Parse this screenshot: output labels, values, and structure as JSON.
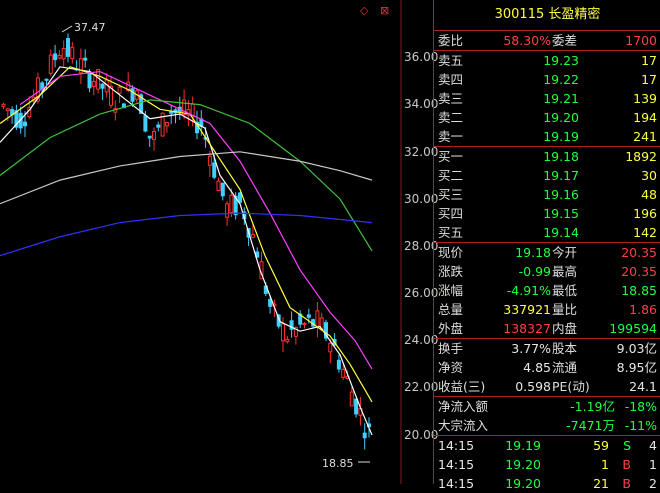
{
  "toolbar": {
    "icons": "◇ ⊠"
  },
  "chart": {
    "y_labels": [
      "36.00",
      "34.00",
      "32.00",
      "30.00",
      "28.00",
      "26.00",
      "24.00",
      "22.00",
      "20.00"
    ],
    "high_label": "37.47",
    "low_label": "18.85",
    "colors": {
      "up": "#ff3030",
      "down": "#40d0ff",
      "ma5": "#ffffff",
      "ma10": "#ffff40",
      "ma20": "#ff40ff",
      "ma60": "#40c040",
      "ma120": "#c8c8c8",
      "ma250": "#3030ff"
    }
  },
  "quote": {
    "title": "300115 长盈精密",
    "weibi_label": "委比",
    "weibi": "58.30%",
    "weicha_label": "委差",
    "weicha": "1700",
    "asks": [
      {
        "label": "卖五",
        "price": "19.23",
        "vol": "17"
      },
      {
        "label": "卖四",
        "price": "19.22",
        "vol": "17"
      },
      {
        "label": "卖三",
        "price": "19.21",
        "vol": "139"
      },
      {
        "label": "卖二",
        "price": "19.20",
        "vol": "194"
      },
      {
        "label": "卖一",
        "price": "19.19",
        "vol": "241"
      }
    ],
    "bids": [
      {
        "label": "买一",
        "price": "19.18",
        "vol": "1892"
      },
      {
        "label": "买二",
        "price": "19.17",
        "vol": "30"
      },
      {
        "label": "买三",
        "price": "19.16",
        "vol": "48"
      },
      {
        "label": "买四",
        "price": "19.15",
        "vol": "196"
      },
      {
        "label": "买五",
        "price": "19.14",
        "vol": "142"
      }
    ],
    "stats": [
      {
        "l1": "现价",
        "v1": "19.18",
        "c1": "green",
        "l2": "今开",
        "v2": "20.35",
        "c2": "red"
      },
      {
        "l1": "涨跌",
        "v1": "-0.99",
        "c1": "green",
        "l2": "最高",
        "v2": "20.35",
        "c2": "red"
      },
      {
        "l1": "涨幅",
        "v1": "-4.91%",
        "c1": "green",
        "l2": "最低",
        "v2": "18.85",
        "c2": "green"
      },
      {
        "l1": "总量",
        "v1": "337921",
        "c1": "yellow",
        "l2": "量比",
        "v2": "1.86",
        "c2": "red"
      },
      {
        "l1": "外盘",
        "v1": "138327",
        "c1": "red",
        "l2": "内盘",
        "v2": "199594",
        "c2": "green"
      }
    ],
    "fund": [
      {
        "l1": "换手",
        "v1": "3.77%",
        "l2": "股本",
        "v2": "9.03亿"
      },
      {
        "l1": "净资",
        "v1": "4.85",
        "l2": "流通",
        "v2": "8.95亿"
      },
      {
        "l1": "收益(三)",
        "v1": "0.598",
        "l2": "PE(动)",
        "v2": "24.1"
      }
    ],
    "flow": [
      {
        "label": "净流入额",
        "v1": "-1.19亿",
        "v2": "-18%"
      },
      {
        "label": "大宗流入",
        "v1": "-7471万",
        "v2": "-11%"
      }
    ],
    "ticks": [
      {
        "time": "14:15",
        "price": "19.19",
        "vol": "59",
        "side": "S",
        "n": "4"
      },
      {
        "time": "14:15",
        "price": "19.20",
        "vol": "1",
        "side": "B",
        "n": "1"
      },
      {
        "time": "14:15",
        "price": "19.20",
        "vol": "21",
        "side": "B",
        "n": "2"
      }
    ]
  }
}
